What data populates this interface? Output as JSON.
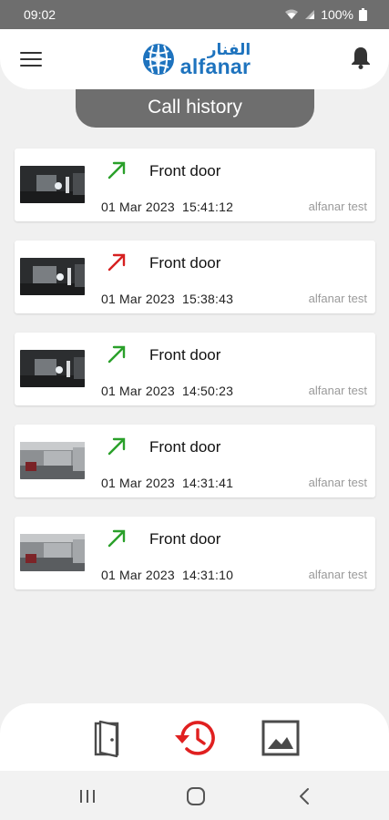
{
  "status_bar": {
    "time": "09:02",
    "battery": "100%"
  },
  "header": {
    "logo_arabic": "الفنار",
    "logo_latin": "alfanar"
  },
  "page_title": "Call history",
  "calls": [
    {
      "caller": "Front door",
      "date": "01 Mar 2023",
      "time": "15:41:12",
      "account": "alfanar test",
      "status": "answered"
    },
    {
      "caller": "Front door",
      "date": "01 Mar 2023",
      "time": "15:38:43",
      "account": "alfanar test",
      "status": "missed"
    },
    {
      "caller": "Front door",
      "date": "01 Mar 2023",
      "time": "14:50:23",
      "account": "alfanar test",
      "status": "answered"
    },
    {
      "caller": "Front door",
      "date": "01 Mar 2023",
      "time": "14:31:41",
      "account": "alfanar test",
      "status": "answered"
    },
    {
      "caller": "Front door",
      "date": "01 Mar 2023",
      "time": "14:31:10",
      "account": "alfanar test",
      "status": "answered"
    }
  ],
  "bottom_nav": {
    "items": [
      {
        "icon": "door-icon",
        "active": false
      },
      {
        "icon": "history-icon",
        "active": true
      },
      {
        "icon": "gallery-icon",
        "active": false
      }
    ]
  },
  "colors": {
    "accent": "#e02020",
    "answered": "#2aa02a",
    "missed": "#d62020",
    "brand": "#1e73be",
    "pill": "#6e6e6e"
  }
}
